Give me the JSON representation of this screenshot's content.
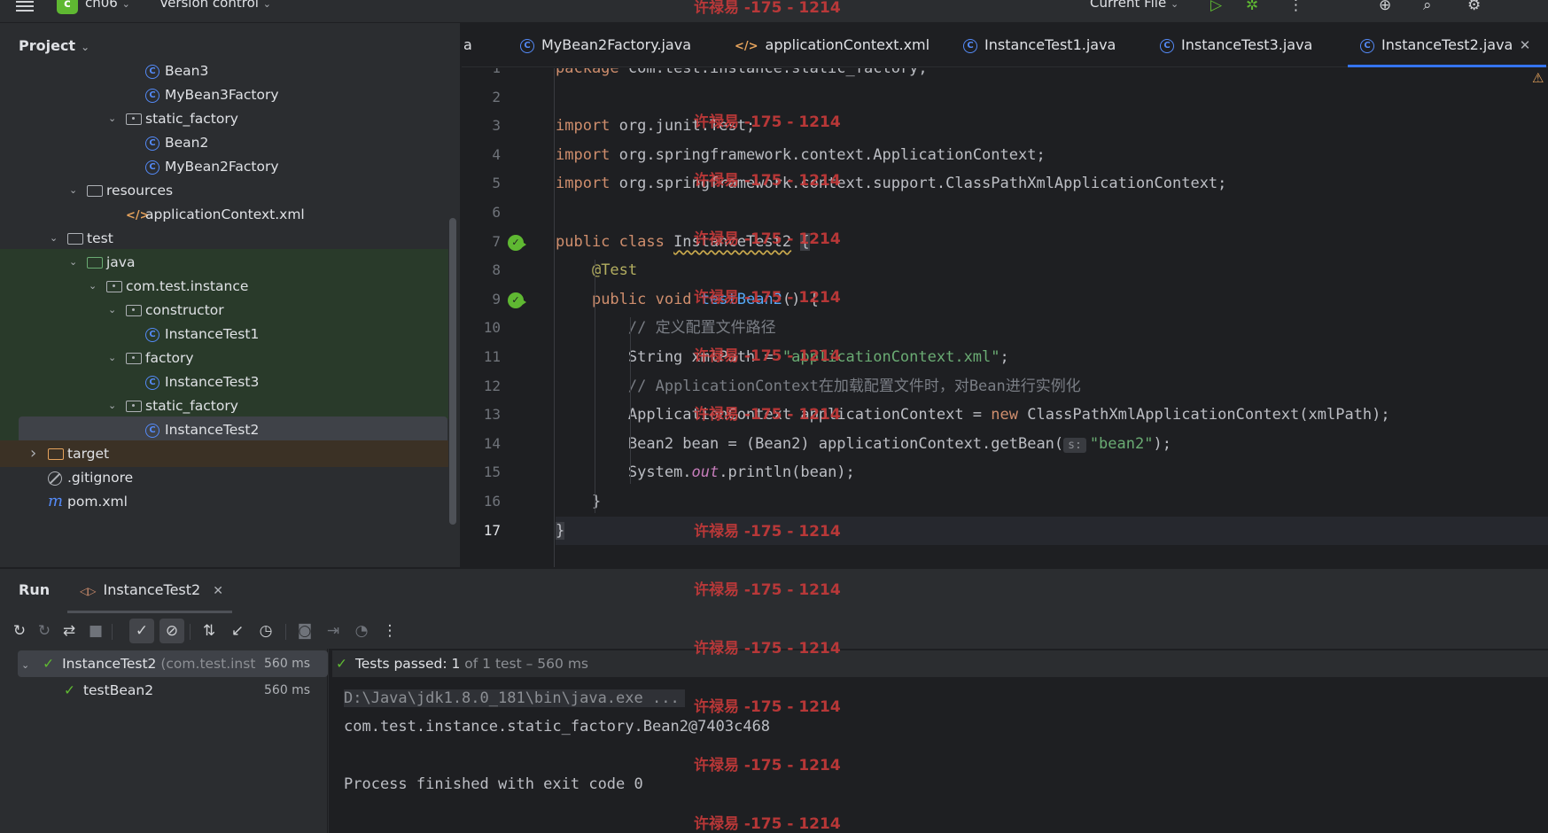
{
  "toolbar": {
    "project_badge": "c",
    "project_name": "ch06",
    "version_control": "Version control",
    "run_config": "Current File"
  },
  "project_panel": {
    "title": "Project",
    "tree": [
      {
        "label": "Bean3",
        "icon": "class-icon",
        "depth": 7,
        "expanded": null,
        "bg": "none"
      },
      {
        "label": "MyBean3Factory",
        "icon": "class-icon",
        "depth": 7,
        "expanded": null,
        "bg": "none"
      },
      {
        "label": "static_factory",
        "icon": "package-icon",
        "depth": 6,
        "expanded": true,
        "bg": "none"
      },
      {
        "label": "Bean2",
        "icon": "class-icon",
        "depth": 7,
        "expanded": null,
        "bg": "none"
      },
      {
        "label": "MyBean2Factory",
        "icon": "class-icon",
        "depth": 7,
        "expanded": null,
        "bg": "none"
      },
      {
        "label": "resources",
        "icon": "resources-folder-icon",
        "depth": 4,
        "expanded": true,
        "bg": "none"
      },
      {
        "label": "applicationContext.xml",
        "icon": "xml-file-icon",
        "depth": 6,
        "expanded": null,
        "bg": "none"
      },
      {
        "label": "test",
        "icon": "folder-icon",
        "depth": 3,
        "expanded": true,
        "bg": "none"
      },
      {
        "label": "java",
        "icon": "test-folder-icon",
        "depth": 4,
        "expanded": true,
        "bg": "green"
      },
      {
        "label": "com.test.instance",
        "icon": "package-icon",
        "depth": 5,
        "expanded": true,
        "bg": "green"
      },
      {
        "label": "constructor",
        "icon": "package-icon",
        "depth": 6,
        "expanded": true,
        "bg": "green"
      },
      {
        "label": "InstanceTest1",
        "icon": "class-icon",
        "depth": 7,
        "expanded": null,
        "bg": "green"
      },
      {
        "label": "factory",
        "icon": "package-icon",
        "depth": 6,
        "expanded": true,
        "bg": "green"
      },
      {
        "label": "InstanceTest3",
        "icon": "class-icon",
        "depth": 7,
        "expanded": null,
        "bg": "green"
      },
      {
        "label": "static_factory",
        "icon": "package-icon",
        "depth": 6,
        "expanded": true,
        "bg": "green"
      },
      {
        "label": "InstanceTest2",
        "icon": "class-icon",
        "depth": 7,
        "expanded": null,
        "bg": "selected"
      },
      {
        "label": "target",
        "icon": "excluded-folder-icon",
        "depth": 2,
        "expanded": false,
        "bg": "brown"
      },
      {
        "label": ".gitignore",
        "icon": "gitignore-icon",
        "depth": 2,
        "expanded": null,
        "bg": "none"
      },
      {
        "label": "pom.xml",
        "icon": "maven-icon",
        "depth": 2,
        "expanded": null,
        "bg": "none"
      }
    ]
  },
  "editor": {
    "tabs": [
      {
        "label": "a",
        "icon": "none",
        "active": false
      },
      {
        "label": "MyBean2Factory.java",
        "icon": "class-icon",
        "active": false
      },
      {
        "label": "applicationContext.xml",
        "icon": "xml-file-icon",
        "active": false
      },
      {
        "label": "InstanceTest1.java",
        "icon": "class-icon",
        "active": false
      },
      {
        "label": "InstanceTest3.java",
        "icon": "class-icon",
        "active": false
      },
      {
        "label": "InstanceTest2.java",
        "icon": "class-icon",
        "active": true
      }
    ],
    "current_line": 17,
    "lines": [
      {
        "n": 1,
        "tokens": [
          {
            "t": "package ",
            "c": "kw"
          },
          {
            "t": "com.test.instance.static_factory;",
            "c": ""
          }
        ]
      },
      {
        "n": 2,
        "tokens": []
      },
      {
        "n": 3,
        "tokens": [
          {
            "t": "import ",
            "c": "kw"
          },
          {
            "t": "org.junit.Test;",
            "c": ""
          }
        ]
      },
      {
        "n": 4,
        "tokens": [
          {
            "t": "import ",
            "c": "kw"
          },
          {
            "t": "org.springframework.context.ApplicationContext;",
            "c": ""
          }
        ]
      },
      {
        "n": 5,
        "tokens": [
          {
            "t": "import ",
            "c": "kw"
          },
          {
            "t": "org.springframework.context.support.ClassPathXmlApplicationContext;",
            "c": ""
          }
        ]
      },
      {
        "n": 6,
        "tokens": []
      },
      {
        "n": 7,
        "run": true,
        "tokens": [
          {
            "t": "public class ",
            "c": "kw"
          },
          {
            "t": "InstanceTest2",
            "c": "squig"
          },
          {
            "t": " ",
            "c": ""
          },
          {
            "t": "{",
            "c": "caret-block"
          }
        ]
      },
      {
        "n": 8,
        "tokens": [
          {
            "t": "    ",
            "c": ""
          },
          {
            "t": "@Test",
            "c": "ann"
          }
        ]
      },
      {
        "n": 9,
        "run": true,
        "tokens": [
          {
            "t": "    ",
            "c": ""
          },
          {
            "t": "public void ",
            "c": "kw"
          },
          {
            "t": "testBean2",
            "c": "fn"
          },
          {
            "t": "() {",
            "c": ""
          }
        ]
      },
      {
        "n": 10,
        "tokens": [
          {
            "t": "        ",
            "c": ""
          },
          {
            "t": "// 定义配置文件路径",
            "c": "cmt"
          }
        ]
      },
      {
        "n": 11,
        "tokens": [
          {
            "t": "        String xmlPath = ",
            "c": ""
          },
          {
            "t": "\"applicationContext.xml\"",
            "c": "str"
          },
          {
            "t": ";",
            "c": ""
          }
        ]
      },
      {
        "n": 12,
        "tokens": [
          {
            "t": "        ",
            "c": ""
          },
          {
            "t": "// ApplicationContext在加载配置文件时，对Bean进行实例化",
            "c": "cmt"
          }
        ]
      },
      {
        "n": 13,
        "tokens": [
          {
            "t": "        ApplicationContext applicationContext = ",
            "c": ""
          },
          {
            "t": "new ",
            "c": "kw"
          },
          {
            "t": "ClassPathXmlApplicationContext(xmlPath);",
            "c": ""
          }
        ]
      },
      {
        "n": 14,
        "tokens": [
          {
            "t": "        Bean2 bean = (Bean2) applicationContext.getBean(",
            "c": ""
          },
          {
            "t": "s:",
            "c": "hint"
          },
          {
            "t": "\"bean2\"",
            "c": "str"
          },
          {
            "t": ");",
            "c": ""
          }
        ]
      },
      {
        "n": 15,
        "tokens": [
          {
            "t": "        System.",
            "c": ""
          },
          {
            "t": "out",
            "c": "stat"
          },
          {
            "t": ".println(bean);",
            "c": ""
          }
        ]
      },
      {
        "n": 16,
        "tokens": [
          {
            "t": "    }",
            "c": ""
          }
        ]
      },
      {
        "n": 17,
        "tokens": [
          {
            "t": "}",
            "c": "caret-block"
          }
        ]
      }
    ]
  },
  "run_panel": {
    "title": "Run",
    "tab_label": "InstanceTest2",
    "tree": {
      "root_label": "InstanceTest2",
      "root_package": "(com.test.inst",
      "root_time": "560 ms",
      "child_label": "testBean2",
      "child_time": "560 ms"
    },
    "status": {
      "prefix": "Tests passed: ",
      "passed": "1",
      "suffix": " of 1 test – 560 ms"
    },
    "console": {
      "command": "D:\\Java\\jdk1.8.0_181\\bin\\java.exe ...",
      "output": "com.test.instance.static_factory.Bean2@7403c468",
      "exit": "Process finished with exit code 0"
    }
  },
  "watermark": "许禄易 -175 - 1214"
}
